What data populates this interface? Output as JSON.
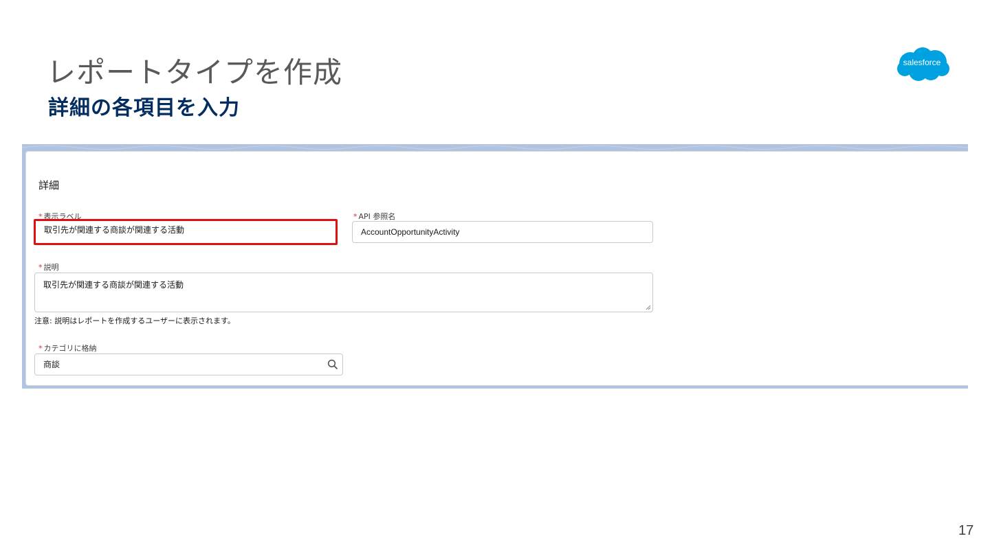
{
  "slide": {
    "title": "レポートタイプを作成",
    "subtitle": "詳細の各項目を入力",
    "page_number": "17"
  },
  "logo": {
    "text": "salesforce",
    "color": "#00a1e0"
  },
  "form": {
    "section_title": "詳細",
    "required_mark": "*",
    "display_label": {
      "label": "表示ラベル",
      "value": "取引先が関連する商談が関連する活動",
      "highlight_color": "#e01010"
    },
    "api_name": {
      "label": "API 参照名",
      "value": "AccountOpportunityActivity"
    },
    "description": {
      "label": "説明",
      "value": "取引先が関連する商談が関連する活動",
      "note": "注意: 説明はレポートを作成するユーザーに表示されます。"
    },
    "category": {
      "label": "カテゴリに格納",
      "value": "商談",
      "icon": "search-icon"
    }
  }
}
